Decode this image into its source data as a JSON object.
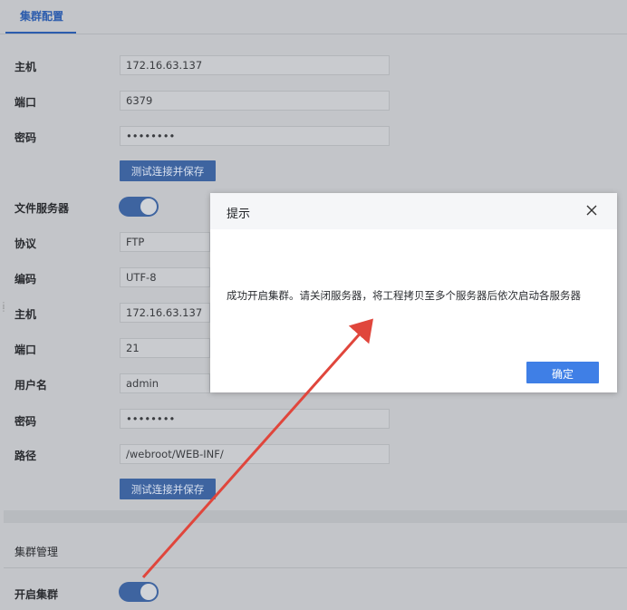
{
  "tab": {
    "active_label": "集群配置"
  },
  "redis": {
    "host_label": "主机",
    "host_value": "172.16.63.137",
    "port_label": "端口",
    "port_value": "6379",
    "password_label": "密码",
    "password_value": "••••••••",
    "test_button": "测试连接并保存"
  },
  "file_server": {
    "label": "文件服务器",
    "enabled": true,
    "protocol_label": "协议",
    "protocol_value": "FTP",
    "encoding_label": "编码",
    "encoding_value": "UTF-8",
    "host_label": "主机",
    "host_value": "172.16.63.137",
    "port_label": "端口",
    "port_value": "21",
    "username_label": "用户名",
    "username_value": "admin",
    "password_label": "密码",
    "password_value": "••••••••",
    "path_label": "路径",
    "path_value": "/webroot/WEB-INF/",
    "test_button": "测试连接并保存"
  },
  "cluster": {
    "section_title": "集群管理",
    "enable_label": "开启集群",
    "enabled": true
  },
  "dialog": {
    "title": "提示",
    "message": "成功开启集群。请关闭服务器，将工程拷贝至多个服务器后依次启动各服务器",
    "ok_button": "确定"
  },
  "colors": {
    "primary": "#3f7fe6",
    "arrow": "#e0463c"
  }
}
